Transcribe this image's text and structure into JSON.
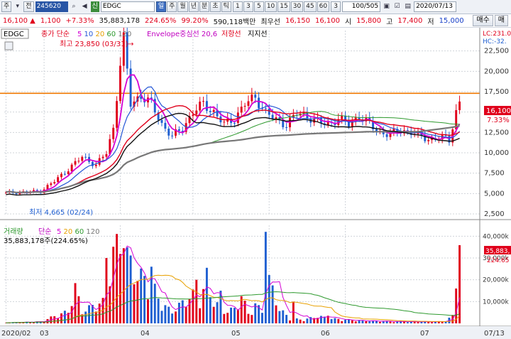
{
  "toolbar": {
    "market_label": "주",
    "prev_label": "전",
    "code_value": "245620",
    "tag_label": "신",
    "name_value": "EDGC",
    "periods": [
      "일",
      "주",
      "월",
      "년",
      "분",
      "초",
      "틱"
    ],
    "selected_period": 0,
    "intervals": [
      "1",
      "3",
      "5",
      "10",
      "15",
      "30",
      "45",
      "60"
    ],
    "interval_selected": "3",
    "count_value": "100/505",
    "date_value": "2020/07/13"
  },
  "quote": {
    "price": "16,100",
    "change": "1,100",
    "change_pct": "+7.33%",
    "volume": "35,883,178",
    "volume_ratio": "224.65%",
    "strength": "99.20%",
    "amount": "590,118백만",
    "label_pref": "최우선",
    "pref_sell": "16,150",
    "pref_buy": "16,100",
    "label_open": "시",
    "open": "15,800",
    "label_high": "고",
    "high": "17,400",
    "label_low": "저",
    "low": "15,000",
    "sell_button": "매수",
    "buy_button": "매"
  },
  "price_panel": {
    "stock_name": "EDGC",
    "ma_label": "종가 단순",
    "ma_periods": [
      "5",
      "10",
      "20",
      "60",
      "120"
    ],
    "envelope_label": "Envelope중심선 20,6",
    "resistance_label": "저항선",
    "support_label": "지지선",
    "high_annotation": "최고 23,850 (03/31)",
    "low_annotation": "최저 4,665 (02/24)",
    "lc_label": "LC:231.0",
    "hc_label": "HC:-32.",
    "current_price_tag": "16,100",
    "current_pct_tag": "7.33%",
    "y_ticks": [
      "22,500",
      "20,000",
      "17,500",
      "15,000",
      "12,500",
      "10,000",
      "7,500",
      "5,000",
      "2,500"
    ]
  },
  "volume_panel": {
    "title": "거래량",
    "ma_label": "단순",
    "ma_periods": [
      "5",
      "20",
      "60",
      "120"
    ],
    "current_volume": "35,883,178주(224.65%)",
    "tag_volume": "35,883,",
    "tag_pct": "224.65",
    "y_ticks": [
      "40,000k",
      "30,000k",
      "20,000k",
      "10,000k"
    ]
  },
  "x_axis": {
    "labels": [
      "2020/02",
      "03",
      "04",
      "05",
      "06",
      "07",
      "07/13"
    ]
  },
  "colors": {
    "up": "#e0001b",
    "down": "#1f5fd1",
    "ma5": "#d400d4",
    "ma10": "#2457d6",
    "ma20": "#e8a000",
    "ma60": "#2f9a2f",
    "ma120": "#777777",
    "resistance": "#f07800"
  },
  "chart_data": {
    "type": "candlestick",
    "resistance_level": 17300,
    "price_ylim": [
      2500,
      25000
    ],
    "volume_ylim": [
      0,
      45000
    ],
    "price_anchors": [
      [
        0,
        5100
      ],
      [
        7,
        5200
      ],
      [
        10,
        5300
      ],
      [
        14,
        6500
      ],
      [
        18,
        8000
      ],
      [
        22,
        9500
      ],
      [
        26,
        8500
      ],
      [
        29,
        10000
      ],
      [
        31,
        13000
      ],
      [
        33,
        21000
      ],
      [
        34,
        23850
      ],
      [
        36,
        16000
      ],
      [
        39,
        17000
      ],
      [
        42,
        16000
      ],
      [
        45,
        13500
      ],
      [
        48,
        12000
      ],
      [
        51,
        13000
      ],
      [
        54,
        15000
      ],
      [
        57,
        16000
      ],
      [
        60,
        15000
      ],
      [
        63,
        13500
      ],
      [
        66,
        14200
      ],
      [
        69,
        16000
      ],
      [
        72,
        16800
      ],
      [
        75,
        15000
      ],
      [
        78,
        14000
      ],
      [
        81,
        13500
      ],
      [
        84,
        14800
      ],
      [
        87,
        14500
      ],
      [
        90,
        13800
      ],
      [
        93,
        13500
      ],
      [
        96,
        14200
      ],
      [
        99,
        13500
      ],
      [
        102,
        14500
      ],
      [
        105,
        13500
      ],
      [
        108,
        12500
      ],
      [
        111,
        12200
      ],
      [
        114,
        12800
      ],
      [
        117,
        12500
      ],
      [
        120,
        12000
      ],
      [
        123,
        11600
      ],
      [
        126,
        11900
      ],
      [
        128,
        11600
      ],
      [
        130,
        15000
      ],
      [
        131,
        16100
      ]
    ],
    "volume_anchors": [
      [
        0,
        300
      ],
      [
        10,
        800
      ],
      [
        14,
        3000
      ],
      [
        18,
        5000
      ],
      [
        20,
        15000
      ],
      [
        22,
        5000
      ],
      [
        26,
        8000
      ],
      [
        28,
        9000
      ],
      [
        29,
        20000
      ],
      [
        31,
        30000
      ],
      [
        33,
        34000
      ],
      [
        35,
        28000
      ],
      [
        38,
        20000
      ],
      [
        40,
        19000
      ],
      [
        43,
        14000
      ],
      [
        45,
        8000
      ],
      [
        48,
        5000
      ],
      [
        52,
        10000
      ],
      [
        54,
        12000
      ],
      [
        55,
        9000
      ],
      [
        57,
        14000
      ],
      [
        59,
        12000
      ],
      [
        61,
        8000
      ],
      [
        63,
        5000
      ],
      [
        66,
        6000
      ],
      [
        68,
        12000
      ],
      [
        70,
        4000
      ],
      [
        72,
        8000
      ],
      [
        74,
        5000
      ],
      [
        76,
        18000
      ],
      [
        79,
        6000
      ],
      [
        82,
        2000
      ],
      [
        86,
        1500
      ],
      [
        90,
        3000
      ],
      [
        94,
        2000
      ],
      [
        98,
        1500
      ],
      [
        102,
        1200
      ],
      [
        106,
        1000
      ],
      [
        110,
        900
      ],
      [
        114,
        800
      ],
      [
        118,
        700
      ],
      [
        122,
        700
      ],
      [
        126,
        800
      ],
      [
        129,
        3000
      ],
      [
        130,
        16000
      ],
      [
        131,
        35883
      ]
    ],
    "volume_spikes": [
      [
        29,
        30000
      ],
      [
        34,
        34500
      ],
      [
        42,
        26000
      ],
      [
        55,
        20000
      ],
      [
        58,
        25500
      ],
      [
        62,
        15000
      ],
      [
        75,
        42000
      ],
      [
        83,
        10000
      ],
      [
        93,
        3500
      ],
      [
        130,
        16000
      ],
      [
        131,
        35883
      ]
    ]
  }
}
